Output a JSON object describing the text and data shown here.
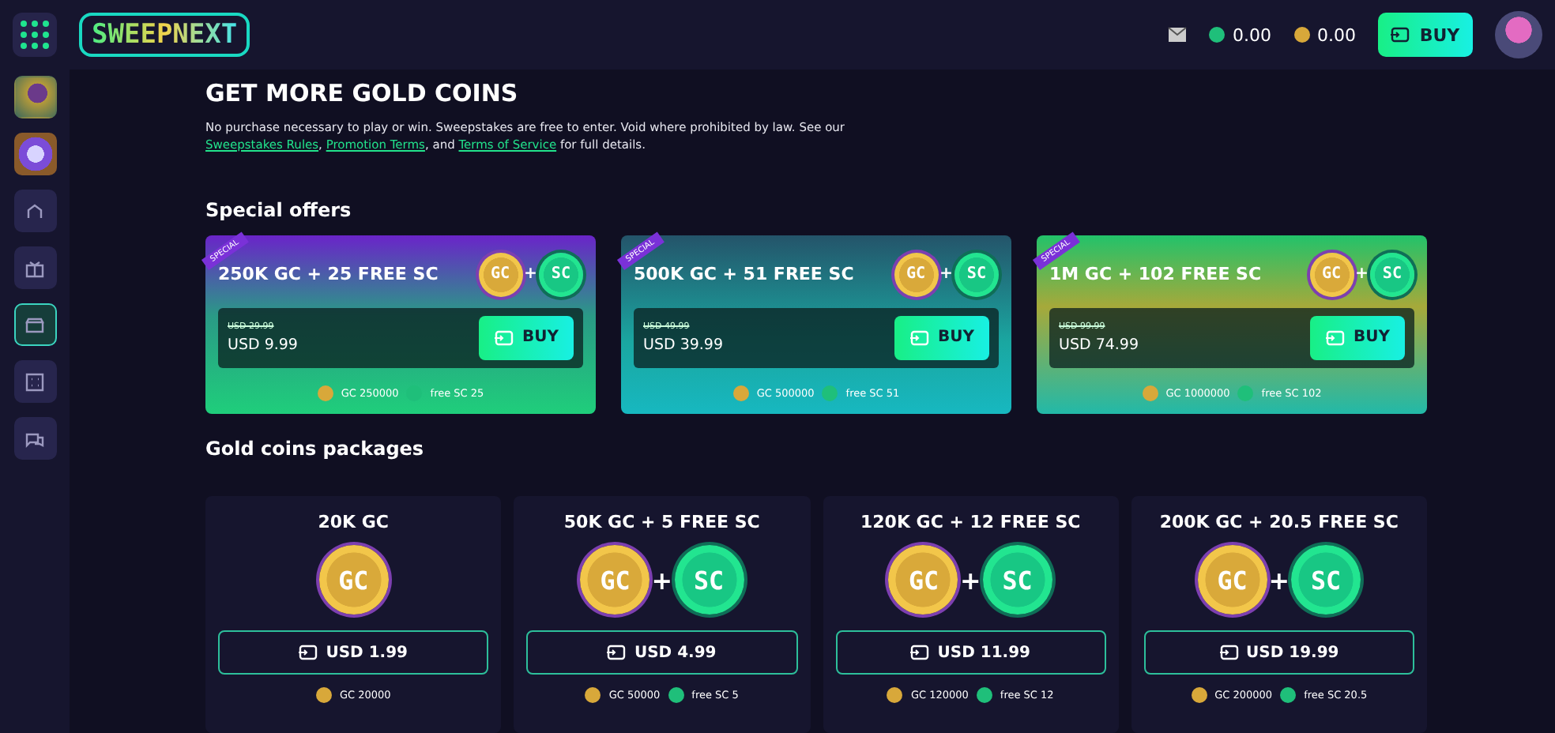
{
  "header": {
    "logo": "SWEEPNEXT",
    "sc_balance": "0.00",
    "gc_balance": "0.00",
    "buy_label": "BUY"
  },
  "sidebar": {
    "items": [
      {
        "kind": "game",
        "selected": false
      },
      {
        "kind": "wheel",
        "selected": false
      },
      {
        "kind": "home",
        "selected": false
      },
      {
        "kind": "gift",
        "selected": false
      },
      {
        "kind": "store",
        "selected": true
      },
      {
        "kind": "dice",
        "selected": false
      },
      {
        "kind": "chat",
        "selected": false
      }
    ]
  },
  "intro": {
    "title": "GET MORE GOLD COINS",
    "text": "No purchase necessary to play or win. Sweepstakes are free to enter. Void where prohibited by law. See our",
    "links": [
      "Sweepstakes Rules",
      "Promotion Terms",
      "Terms of Service"
    ],
    "sep1": ",",
    "sep2": ", and",
    "tail": "for full details."
  },
  "special_offers": {
    "heading": "Special offers",
    "items": [
      {
        "ribbon": "SPECIAL",
        "title": "250K GC + 25 FREE SC",
        "coin_labels": [
          "GC",
          "SC"
        ],
        "joiner": "+",
        "old_price": "USD 29.99",
        "price": "USD 9.99",
        "buy_label": "BUY",
        "gc": "GC 250000",
        "sc": "free SC 25",
        "kind": "purple"
      },
      {
        "ribbon": "SPECIAL",
        "title": "500K GC + 51 FREE SC",
        "coin_labels": [
          "GC",
          "SC"
        ],
        "joiner": "+",
        "old_price": "USD 49.99",
        "price": "USD 39.99",
        "buy_label": "BUY",
        "gc": "GC 500000",
        "sc": "free SC 51",
        "kind": "teal"
      },
      {
        "ribbon": "SPECIAL",
        "title": "1M GC + 102 FREE SC",
        "coin_labels": [
          "GC",
          "SC"
        ],
        "joiner": "+",
        "old_price": "USD 99.99",
        "price": "USD 74.99",
        "buy_label": "BUY",
        "gc": "GC 1000000",
        "sc": "free SC 102",
        "kind": "gold"
      }
    ]
  },
  "packages": {
    "heading": "Gold coins packages",
    "items": [
      {
        "title": "20K GC",
        "coin_labels": [
          "GC"
        ],
        "price": "USD 1.99",
        "gc": "GC 20000"
      },
      {
        "title": "50K GC + 5 FREE SC",
        "coin_labels": [
          "GC",
          "SC"
        ],
        "joiner": "+",
        "price": "USD 4.99",
        "gc": "GC 50000",
        "sc": "free SC 5"
      },
      {
        "title": "120K GC + 12 FREE SC",
        "coin_labels": [
          "GC",
          "SC"
        ],
        "joiner": "+",
        "price": "USD 11.99",
        "gc": "GC 120000",
        "sc": "free SC 12"
      },
      {
        "title": "200K GC + 20.5 FREE SC",
        "coin_labels": [
          "GC",
          "SC"
        ],
        "joiner": "+",
        "price": "USD 19.99",
        "gc": "GC 200000",
        "sc": "free SC 20.5"
      }
    ]
  }
}
